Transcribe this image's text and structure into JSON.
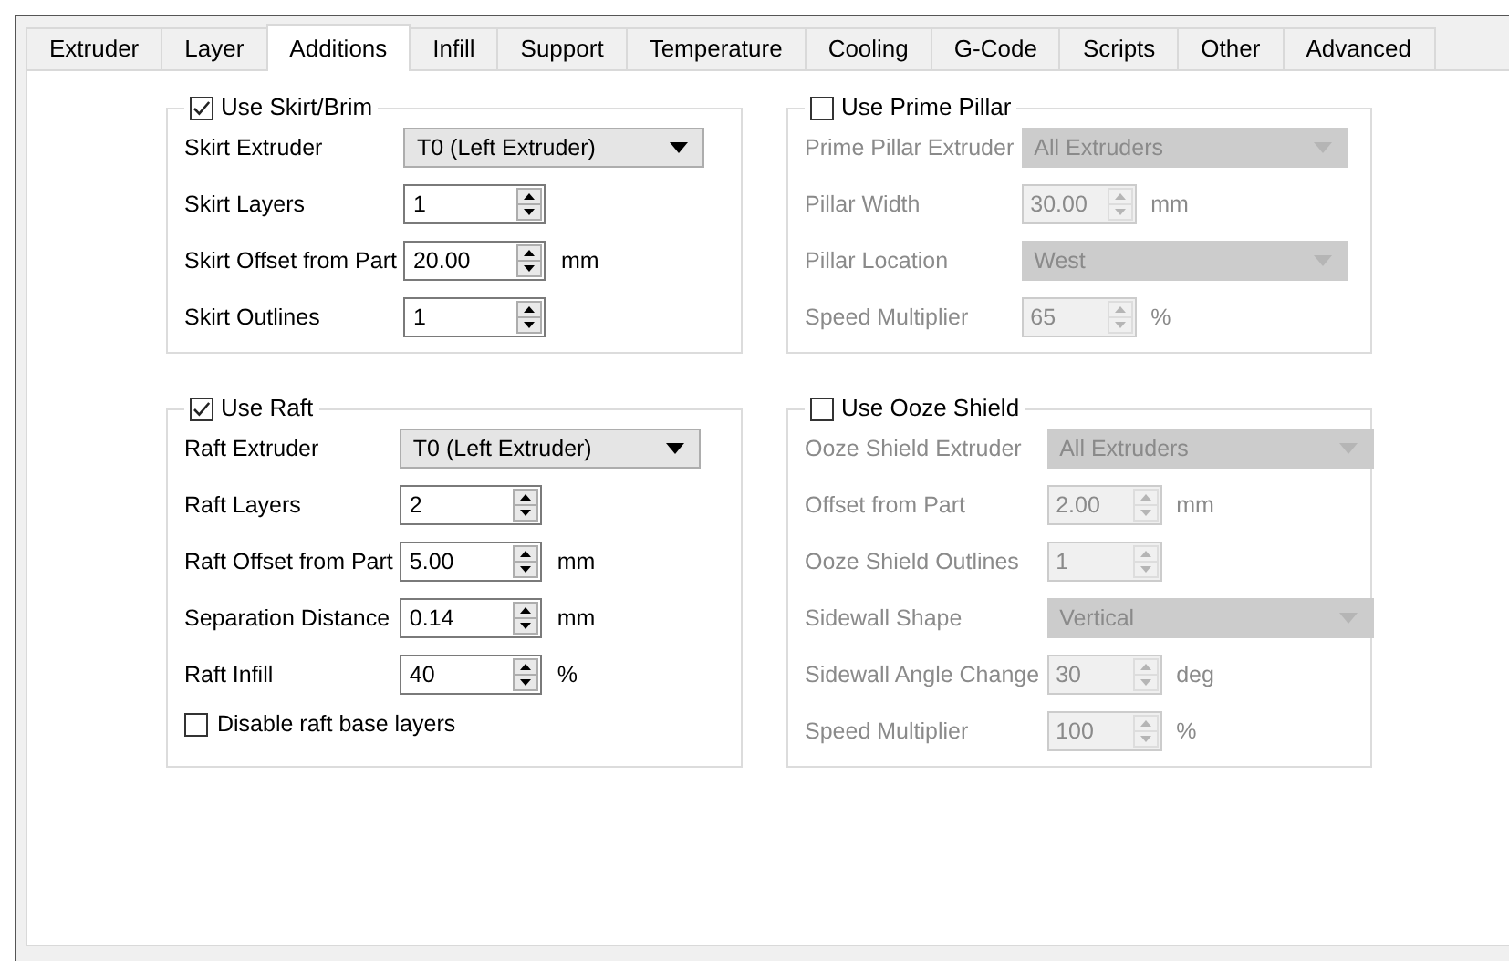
{
  "tabs": [
    {
      "label": "Extruder",
      "selected": false
    },
    {
      "label": "Layer",
      "selected": false
    },
    {
      "label": "Additions",
      "selected": true
    },
    {
      "label": "Infill",
      "selected": false
    },
    {
      "label": "Support",
      "selected": false
    },
    {
      "label": "Temperature",
      "selected": false
    },
    {
      "label": "Cooling",
      "selected": false
    },
    {
      "label": "G-Code",
      "selected": false
    },
    {
      "label": "Scripts",
      "selected": false
    },
    {
      "label": "Other",
      "selected": false
    },
    {
      "label": "Advanced",
      "selected": false
    }
  ],
  "groups": [
    {
      "title": "Use Skirt/Brim",
      "checked": true,
      "rows": [
        {
          "kind": "combo",
          "label": "Skirt Extruder",
          "value": "T0 (Left Extruder)",
          "disabled": false
        },
        {
          "kind": "spin",
          "label": "Skirt Layers",
          "value": "1",
          "disabled": false
        },
        {
          "kind": "spin",
          "label": "Skirt Offset from Part",
          "value": "20.00",
          "unit": "mm",
          "disabled": false
        },
        {
          "kind": "spin",
          "label": "Skirt Outlines",
          "value": "1",
          "disabled": false
        }
      ]
    },
    {
      "title": "Use Prime Pillar",
      "checked": false,
      "rows": [
        {
          "kind": "combo",
          "label": "Prime Pillar Extruder",
          "value": "All Extruders",
          "disabled": true
        },
        {
          "kind": "spin",
          "label": "Pillar Width",
          "value": "30.00",
          "unit": "mm",
          "disabled": true
        },
        {
          "kind": "combo",
          "label": "Pillar Location",
          "value": "West",
          "disabled": true
        },
        {
          "kind": "spin",
          "label": "Speed Multiplier",
          "value": "65",
          "unit": "%",
          "disabled": true
        }
      ]
    },
    {
      "title": "Use Raft",
      "checked": true,
      "rows": [
        {
          "kind": "combo",
          "label": "Raft Extruder",
          "value": "T0 (Left Extruder)",
          "disabled": false
        },
        {
          "kind": "spin",
          "label": "Raft Layers",
          "value": "2",
          "disabled": false
        },
        {
          "kind": "spin",
          "label": "Raft Offset from Part",
          "value": "5.00",
          "unit": "mm",
          "disabled": false
        },
        {
          "kind": "spin",
          "label": "Separation Distance",
          "value": "0.14",
          "unit": "mm",
          "disabled": false
        },
        {
          "kind": "spin",
          "label": "Raft Infill",
          "value": "40",
          "unit": "%",
          "disabled": false
        },
        {
          "kind": "checkbox",
          "label": "Disable raft base layers",
          "checked": false
        }
      ]
    },
    {
      "title": "Use Ooze Shield",
      "checked": false,
      "rows": [
        {
          "kind": "combo",
          "label": "Ooze Shield Extruder",
          "value": "All Extruders",
          "disabled": true
        },
        {
          "kind": "spin",
          "label": "Offset from Part",
          "value": "2.00",
          "unit": "mm",
          "disabled": true
        },
        {
          "kind": "spin",
          "label": "Ooze Shield Outlines",
          "value": "1",
          "disabled": true
        },
        {
          "kind": "combo",
          "label": "Sidewall Shape",
          "value": "Vertical",
          "disabled": true
        },
        {
          "kind": "spin",
          "label": "Sidewall Angle Change",
          "value": "30",
          "unit": "deg",
          "disabled": true
        },
        {
          "kind": "spin",
          "label": "Speed Multiplier",
          "value": "100",
          "unit": "%",
          "disabled": true
        }
      ]
    }
  ]
}
